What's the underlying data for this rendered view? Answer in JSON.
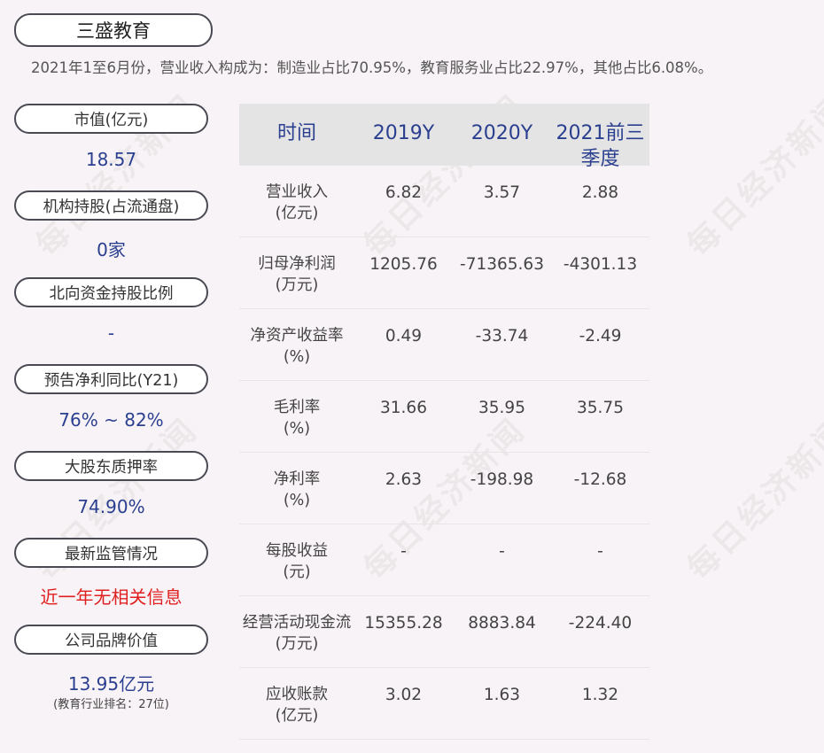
{
  "header": {
    "title": "三盛教育",
    "subtitle": "2021年1至6月份，营业收入构成为：制造业占比70.95%，教育服务业占比22.97%，其他占比6.08%。"
  },
  "watermark": "每日经济新闻",
  "metrics": [
    {
      "label": "市值(亿元)",
      "value": "18.57"
    },
    {
      "label": "机构持股(占流通盘)",
      "value": "0家"
    },
    {
      "label": "北向资金持股比例",
      "value": "-"
    },
    {
      "label": "预告净利同比(Y21)",
      "value": "76% ~ 82%"
    },
    {
      "label": "大股东质押率",
      "value": "74.90%"
    },
    {
      "label": "最新监管情况",
      "value": "近一年无相关信息"
    },
    {
      "label": "公司品牌价值",
      "value": "13.95亿元",
      "note": "(教育行业排名：27位)"
    }
  ],
  "table": {
    "headers": [
      "时间",
      "2019Y",
      "2020Y",
      "2021前三季度"
    ],
    "rows": [
      {
        "label1": "营业收入",
        "label2": "(亿元)",
        "values": [
          "6.82",
          "3.57",
          "2.88"
        ]
      },
      {
        "label1": "归母净利润",
        "label2": "(万元)",
        "values": [
          "1205.76",
          "-71365.63",
          "-4301.13"
        ]
      },
      {
        "label1": "净资产收益率",
        "label2": "(%)",
        "values": [
          "0.49",
          "-33.74",
          "-2.49"
        ]
      },
      {
        "label1": "毛利率",
        "label2": "(%)",
        "values": [
          "31.66",
          "35.95",
          "35.75"
        ]
      },
      {
        "label1": "净利率",
        "label2": "(%)",
        "values": [
          "2.63",
          "-198.98",
          "-12.68"
        ]
      },
      {
        "label1": "每股收益",
        "label2": "(元)",
        "values": [
          "-",
          "-",
          "-"
        ]
      },
      {
        "label1": "经营活动现金流",
        "label2": "(万元)",
        "values": [
          "15355.28",
          "8883.84",
          "-224.40"
        ]
      },
      {
        "label1": "应收账款",
        "label2": "(亿元)",
        "values": [
          "3.02",
          "1.63",
          "1.32"
        ]
      }
    ]
  },
  "colors": {
    "background": "#f8f3f6",
    "accent_blue": "#2a3f8f",
    "alert_red": "#e02020",
    "header_bg": "#e4e4e4"
  }
}
